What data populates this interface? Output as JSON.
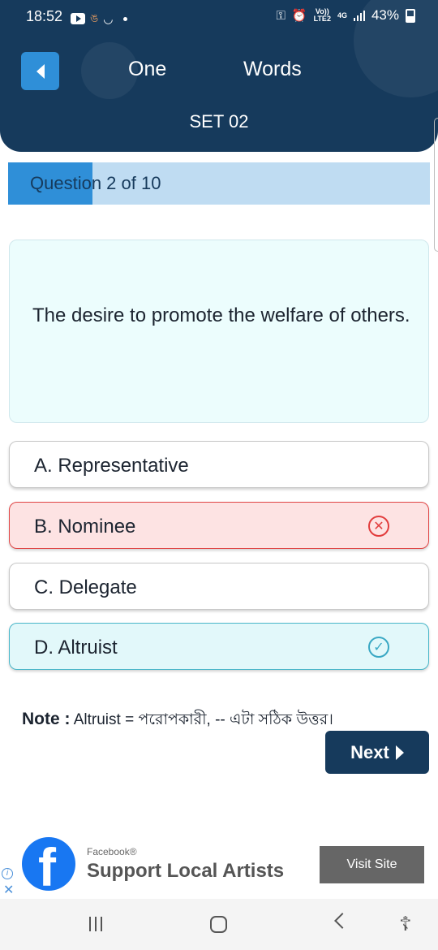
{
  "status_bar": {
    "time": "18:52",
    "net_top": "Vo))",
    "net_bottom": "LTE2",
    "net_type": "4G",
    "battery": "43%"
  },
  "header": {
    "title_part1": "One",
    "title_part2": "Words",
    "set": "SET 02"
  },
  "progress": {
    "text": "Question 2 of 10",
    "value": 0.2
  },
  "question": {
    "text": "The desire to promote the welfare of others."
  },
  "options": [
    {
      "label": "A. Representative",
      "state": "normal"
    },
    {
      "label": "B. Nominee",
      "state": "wrong"
    },
    {
      "label": "C. Delegate",
      "state": "normal"
    },
    {
      "label": "D. Altruist",
      "state": "correct"
    }
  ],
  "note": {
    "label": "Note :",
    "text": "Altruist  = পরোপকারী,   -- এটা সঠিক উত্তর।"
  },
  "next_button": {
    "label": "Next"
  },
  "ad": {
    "advertiser": "Facebook®",
    "headline": "Support Local Artists",
    "cta": "Visit Site"
  },
  "icons": {
    "wrong": "x-circle-icon",
    "correct": "check-circle-icon",
    "back": "back-arrow-icon"
  },
  "colors": {
    "header_bg": "#163a5c",
    "accent": "#2f8fd8",
    "wrong": "#e04545",
    "correct": "#49b6c9"
  }
}
